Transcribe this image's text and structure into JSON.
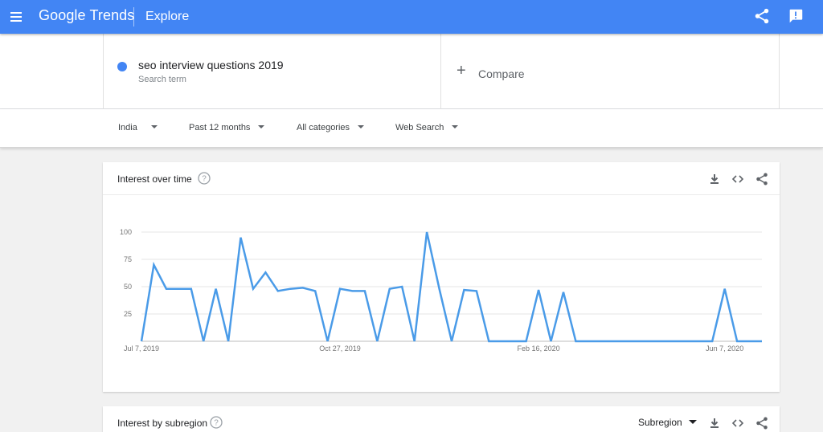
{
  "header": {
    "logo_google": "Google",
    "logo_trends": "Trends",
    "page": "Explore"
  },
  "search": {
    "term": "seo interview questions 2019",
    "term_type": "Search term",
    "term_color": "#4285f4",
    "compare_label": "Compare"
  },
  "filters": {
    "region": "India",
    "time_range": "Past 12 months",
    "category": "All categories",
    "search_type": "Web Search"
  },
  "interest_over_time": {
    "title": "Interest over time"
  },
  "interest_by_subregion": {
    "title": "Interest by subregion",
    "resolution": "Subregion"
  },
  "colors": {
    "brand": "#4285f4",
    "line": "#4a9be8"
  },
  "chart_data": {
    "type": "line",
    "ylim": [
      0,
      100
    ],
    "yticks": [
      25,
      50,
      75,
      100
    ],
    "xtick_labels": [
      {
        "label": "Jul 7, 2019",
        "index": 0
      },
      {
        "label": "Oct 27, 2019",
        "index": 16
      },
      {
        "label": "Feb 16, 2020",
        "index": 32
      },
      {
        "label": "Jun 7, 2020",
        "index": 47
      }
    ],
    "series": [
      {
        "values": [
          0,
          70,
          48,
          48,
          48,
          0,
          48,
          0,
          95,
          48,
          63,
          46,
          48,
          49,
          46,
          0,
          48,
          46,
          46,
          0,
          48,
          50,
          0,
          100,
          48,
          0,
          47,
          46,
          0,
          0,
          0,
          0,
          47,
          0,
          45,
          0,
          0,
          0,
          0,
          0,
          0,
          0,
          0,
          0,
          0,
          0,
          0,
          48,
          0,
          0,
          0
        ]
      }
    ]
  }
}
